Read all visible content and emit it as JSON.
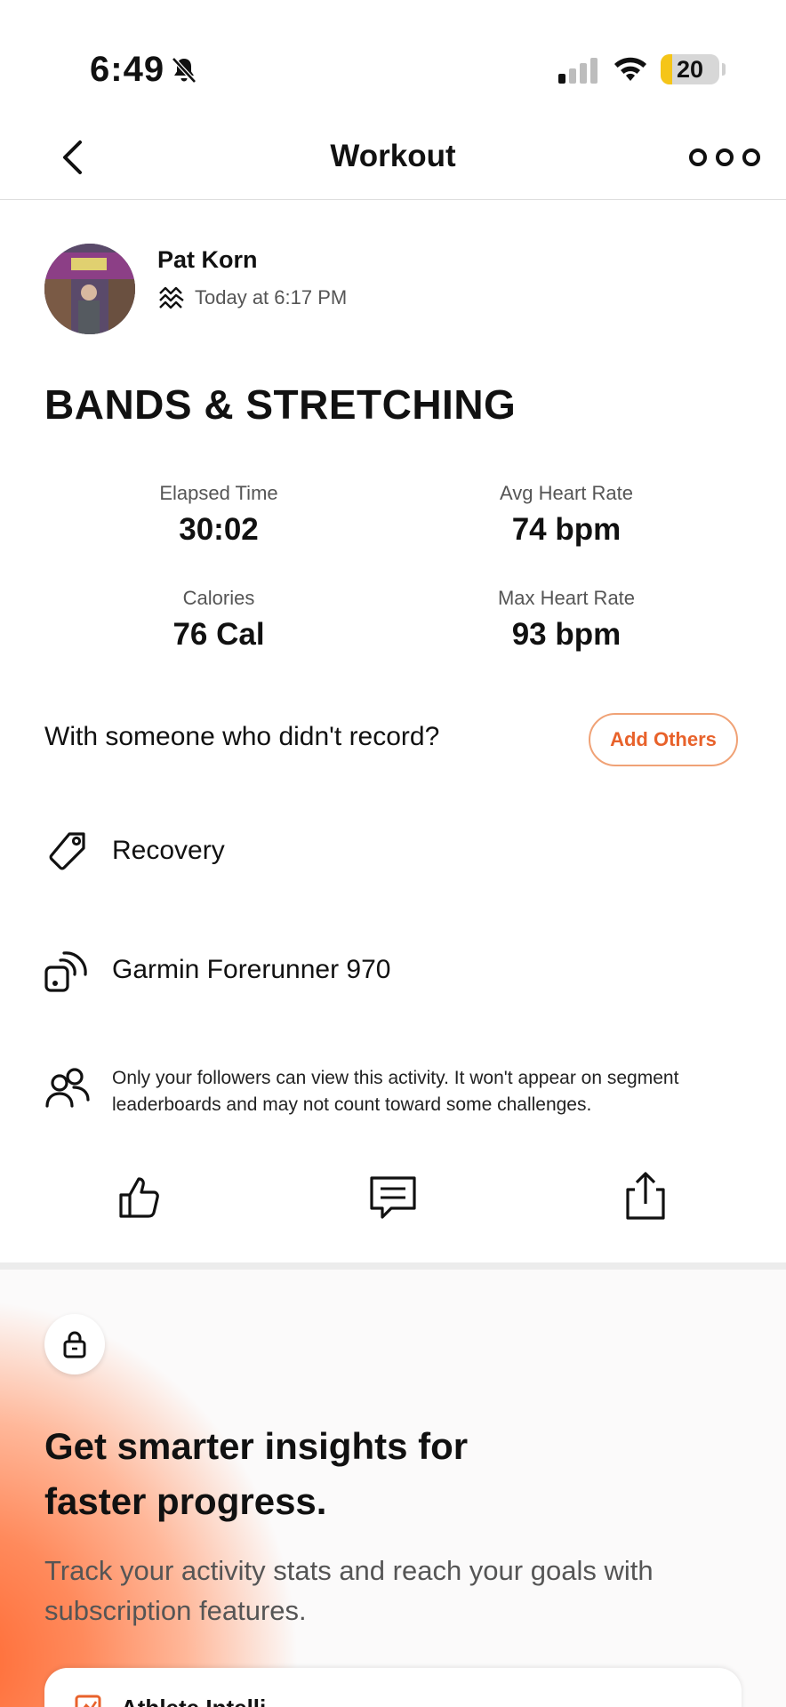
{
  "status_bar": {
    "time": "6:49",
    "battery_percent": "20",
    "battery_level": 0.2,
    "battery_color": "#f5c518"
  },
  "nav": {
    "title": "Workout",
    "back_icon": "chevron-left-icon",
    "more_icon": "more-dots-icon"
  },
  "athlete": {
    "name": "Pat Korn",
    "activity_type_icon": "activity-wave-icon",
    "timestamp": "Today at 6:17 PM"
  },
  "activity": {
    "title": "BANDS & STRETCHING"
  },
  "stats": [
    {
      "label": "Elapsed Time",
      "value": "30:02"
    },
    {
      "label": "Avg Heart Rate",
      "value": "74 bpm"
    },
    {
      "label": "Calories",
      "value": "76 Cal"
    },
    {
      "label": "Max Heart Rate",
      "value": "93 bpm"
    }
  ],
  "with_others": {
    "prompt": "With someone who didn't record?",
    "button_label": "Add Others",
    "accent_color": "#e8622b"
  },
  "details": {
    "tag": "Recovery",
    "device": "Garmin Forerunner 970",
    "privacy": "Only your followers can view this activity. It won't appear on segment leaderboards and may not count toward some challenges."
  },
  "actions": {
    "kudos_icon": "thumbs-up-icon",
    "comment_icon": "comment-icon",
    "share_icon": "share-icon"
  },
  "promo": {
    "headline": "Get smarter insights for faster progress.",
    "subtext": "Track your activity stats and reach your goals with subscription features.",
    "card_label": "Athlete Intelli",
    "gradient_color": "#ff6a33"
  }
}
